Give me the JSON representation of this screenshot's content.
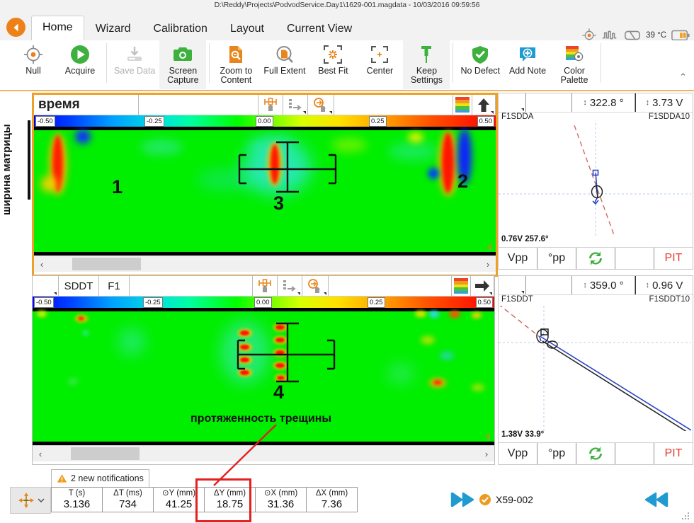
{
  "titlebar": {
    "path": "D:\\Reddy\\Projects\\PodvodService.Day1\\1629-001.magdata - 10/03/2016 09:59:56"
  },
  "tabs": [
    {
      "label": "Home",
      "active": true
    },
    {
      "label": "Wizard",
      "active": false
    },
    {
      "label": "Calibration",
      "active": false
    },
    {
      "label": "Layout",
      "active": false
    },
    {
      "label": "Current View",
      "active": false
    }
  ],
  "ribbon": {
    "items": [
      {
        "label": "Null",
        "icon": "null-target-icon",
        "state": "enabled"
      },
      {
        "label": "Acquire",
        "icon": "play-circle-icon",
        "state": "enabled"
      },
      {
        "label": "Save Data",
        "icon": "save-download-icon",
        "state": "disabled"
      },
      {
        "label": "Screen\nCapture",
        "icon": "camera-icon",
        "state": "highlighted"
      },
      {
        "label": "Zoom to\nContent",
        "icon": "zoom-document-icon",
        "state": "enabled"
      },
      {
        "label": "Full Extent",
        "icon": "magnifier-page-icon",
        "state": "enabled"
      },
      {
        "label": "Best Fit",
        "icon": "best-fit-icon",
        "state": "enabled"
      },
      {
        "label": "Center",
        "icon": "center-crop-icon",
        "state": "enabled"
      },
      {
        "label": "Keep\nSettings",
        "icon": "pushpin-icon",
        "state": "highlighted"
      },
      {
        "label": "No Defect",
        "icon": "shield-check-icon",
        "state": "enabled"
      },
      {
        "label": "Add Note",
        "icon": "add-note-icon",
        "state": "enabled"
      },
      {
        "label": "Color\nPalette",
        "icon": "color-palette-icon",
        "state": "enabled"
      }
    ],
    "collapse_glyph": "⌃"
  },
  "status_icons": {
    "target": "target-icon",
    "waveform": "waveform-icon",
    "coil": "coil-icon",
    "temperature": "39 °C",
    "battery": "battery-icon"
  },
  "panel_top": {
    "title": "время",
    "tool_icons": [
      "probe-balance-icon",
      "list-arrow-icon",
      "zoom-out-hand-icon"
    ],
    "palette_icon": "color-palette-strip-icon",
    "direction_icon": "arrow-up-icon",
    "colorbar": {
      "min": "-0.50",
      "ticks": [
        "-0.50",
        "-0.25",
        "0.00",
        "0.25",
        "0.50"
      ],
      "max": "0.50"
    },
    "markers": [
      "1",
      "2",
      "3"
    ],
    "scroll": {
      "left_arrow": "‹",
      "right_arrow": "›"
    }
  },
  "panel_bottom": {
    "title": "",
    "group_label": "SDDT",
    "freq_label": "F1",
    "tool_icons": [
      "probe-balance-icon",
      "list-arrow-icon",
      "zoom-out-hand-icon"
    ],
    "palette_icon": "color-palette-strip-icon",
    "direction_icon": "arrow-right-icon",
    "colorbar": {
      "min": "-0.50",
      "ticks": [
        "-0.50",
        "-0.25",
        "0.00",
        "0.25",
        "0.50"
      ],
      "max": "0.50"
    },
    "markers": [
      "4"
    ],
    "scroll": {
      "left_arrow": "‹",
      "right_arrow": "›"
    }
  },
  "right_panel_top": {
    "angle": "322.8 °",
    "voltage": "3.73 V",
    "channel_left": "F1SDDA",
    "channel_right": "F1SDDA10",
    "readout": "0.76V 257.6°",
    "buttons": [
      "Vpp",
      "°pp",
      "refresh-icon",
      "",
      "PIT"
    ]
  },
  "right_panel_bottom": {
    "angle": "359.0 °",
    "voltage": "0.96 V",
    "channel_left": "F1SDDT",
    "channel_right": "F1SDDT10",
    "readout": "1.38V 33.9°",
    "buttons": [
      "Vpp",
      "°pp",
      "refresh-icon",
      "",
      "PIT"
    ]
  },
  "annotations": {
    "left_vertical": "ширина\nматрицы",
    "crack_extent": "протяженность трещины"
  },
  "notifications": {
    "icon": "warning-icon",
    "text": "2 new notifications"
  },
  "measurements": [
    {
      "header": "T (s)",
      "value": "3.136",
      "highlighted": false
    },
    {
      "header": "ΔT (ms)",
      "value": "734",
      "highlighted": false
    },
    {
      "header": "⊙Y (mm)",
      "value": "41.25",
      "highlighted": false
    },
    {
      "header": "ΔY (mm)",
      "value": "18.75",
      "highlighted": true
    },
    {
      "header": "⊙X (mm)",
      "value": "31.36",
      "highlighted": false
    },
    {
      "header": "ΔX (mm)",
      "value": "7.36",
      "highlighted": false
    }
  ],
  "bottom_nav": {
    "prev_icon": "skip-back-icon",
    "status_icon": "check-circle-icon",
    "record": "X59-002",
    "next_icon": "skip-forward-icon"
  },
  "colors": {
    "accent": "#ee8018",
    "focus_border": "#eda02a",
    "highlight_red": "#e41f1f",
    "pit_red": "#e23b2e",
    "nav_blue": "#1f9bd1",
    "green_bg": "#00ee00"
  }
}
